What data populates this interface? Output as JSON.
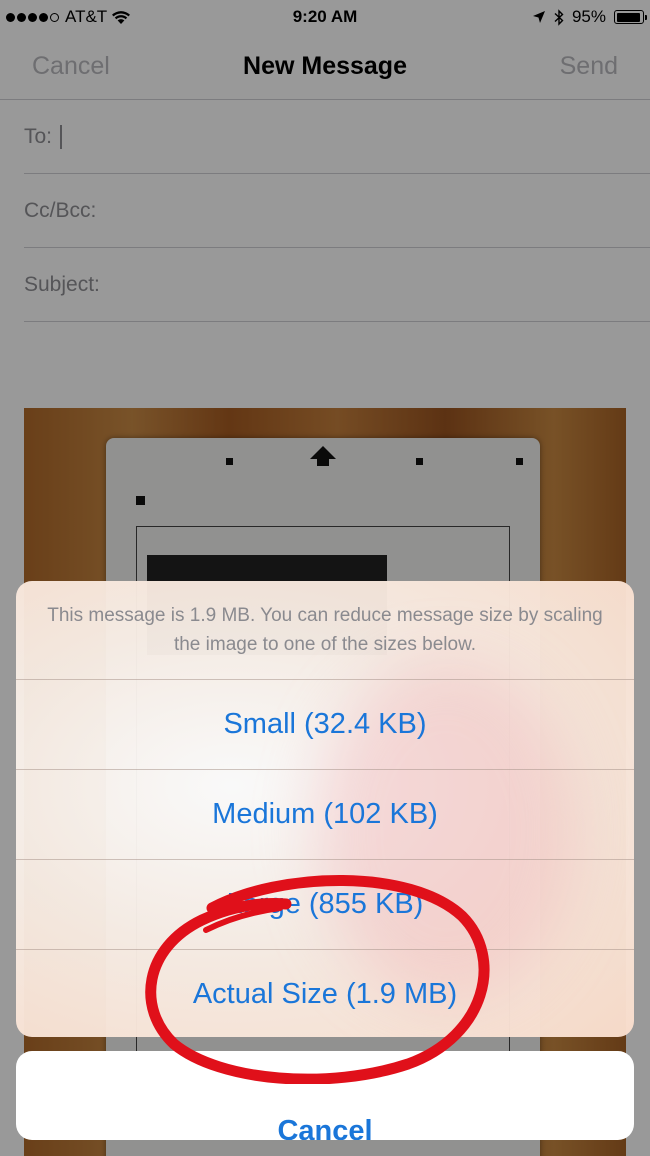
{
  "status_bar": {
    "carrier": "AT&T",
    "time": "9:20 AM",
    "battery": "95%",
    "battery_level": 0.95,
    "icons": [
      "signal-dots-icon",
      "wifi-icon",
      "location-arrow-icon",
      "bluetooth-icon",
      "battery-icon"
    ]
  },
  "nav": {
    "cancel": "Cancel",
    "title": "New Message",
    "send": "Send"
  },
  "compose": {
    "to_label": "To:",
    "cc_label": "Cc/Bcc:",
    "subject_label": "Subject:"
  },
  "action_sheet": {
    "message": "This message is 1.9 MB. You can reduce message size by scaling the image to one of the sizes below.",
    "options": [
      {
        "label": "Small (32.4 KB)"
      },
      {
        "label": "Medium (102 KB)"
      },
      {
        "label": "Large (855 KB)"
      },
      {
        "label": "Actual Size (1.9 MB)"
      }
    ],
    "cancel": "Cancel"
  },
  "colors": {
    "link_blue": "#1a76d9",
    "annotation_red": "#e0101a"
  }
}
